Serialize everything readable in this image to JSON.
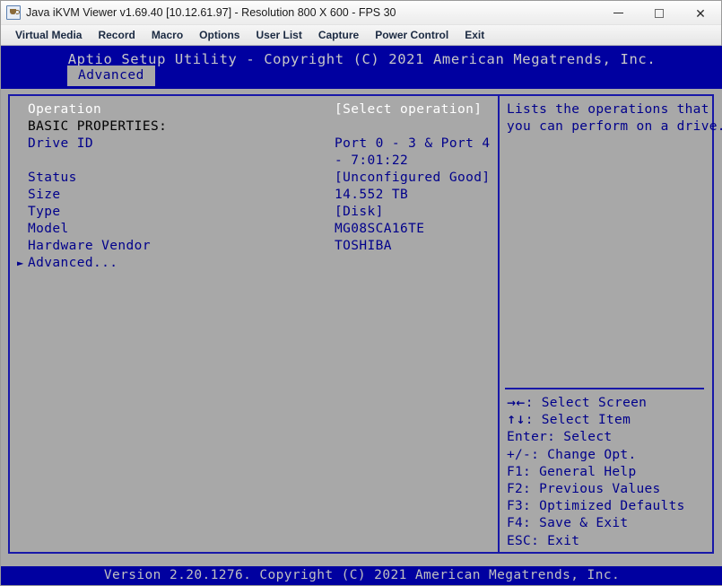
{
  "window": {
    "title": "Java iKVM Viewer v1.69.40 [10.12.61.97]  - Resolution 800 X 600 - FPS 30",
    "icon": "java-icon",
    "controls": {
      "minimize": "minimize-icon",
      "maximize": "maximize-icon",
      "close": "close-icon"
    }
  },
  "menubar": {
    "items": [
      {
        "label": "Virtual Media"
      },
      {
        "label": "Record"
      },
      {
        "label": "Macro"
      },
      {
        "label": "Options"
      },
      {
        "label": "User List"
      },
      {
        "label": "Capture"
      },
      {
        "label": "Power Control"
      },
      {
        "label": "Exit"
      }
    ]
  },
  "bios": {
    "header_title": "Aptio Setup Utility - Copyright (C) 2021 American Megatrends, Inc.",
    "active_tab": "Advanced",
    "rows": [
      {
        "label": "Operation",
        "value": "[Select operation]",
        "selected": true,
        "section": false,
        "arrow": false
      },
      {
        "label": "BASIC PROPERTIES:",
        "value": "",
        "selected": false,
        "section": true,
        "arrow": false
      },
      {
        "label": "Drive ID",
        "value": "Port 0 - 3 & Port 4",
        "selected": false,
        "section": false,
        "arrow": false
      },
      {
        "label": "",
        "value": "- 7:01:22",
        "selected": false,
        "section": false,
        "arrow": false
      },
      {
        "label": "Status",
        "value": "[Unconfigured Good]",
        "selected": false,
        "section": false,
        "arrow": false
      },
      {
        "label": "Size",
        "value": "14.552 TB",
        "selected": false,
        "section": false,
        "arrow": false
      },
      {
        "label": "Type",
        "value": "[Disk]",
        "selected": false,
        "section": false,
        "arrow": false
      },
      {
        "label": "Model",
        "value": "MG08SCA16TE",
        "selected": false,
        "section": false,
        "arrow": false
      },
      {
        "label": "Hardware Vendor",
        "value": "TOSHIBA",
        "selected": false,
        "section": false,
        "arrow": false
      },
      {
        "label": "Advanced...",
        "value": "",
        "selected": false,
        "section": false,
        "arrow": true
      }
    ],
    "help": {
      "lines": [
        "Lists the operations that",
        "you can perform on a drive."
      ]
    },
    "keys": [
      {
        "glyph": "→←",
        "text": ": Select Screen"
      },
      {
        "glyph": "↑↓",
        "text": ": Select Item"
      },
      {
        "glyph": "",
        "text": "Enter: Select"
      },
      {
        "glyph": "",
        "text": "+/-: Change Opt."
      },
      {
        "glyph": "",
        "text": "F1: General Help"
      },
      {
        "glyph": "",
        "text": "F2: Previous Values"
      },
      {
        "glyph": "",
        "text": "F3: Optimized Defaults"
      },
      {
        "glyph": "",
        "text": "F4: Save & Exit"
      },
      {
        "glyph": "",
        "text": "ESC: Exit"
      }
    ],
    "footer": "Version 2.20.1276. Copyright (C) 2021 American Megatrends, Inc."
  },
  "colors": {
    "bios_blue": "#0000a0",
    "panel_gray": "#a8a8a8",
    "label_blue": "#00008b",
    "selected_white": "#ffffff",
    "border_blue": "#1818a8"
  }
}
